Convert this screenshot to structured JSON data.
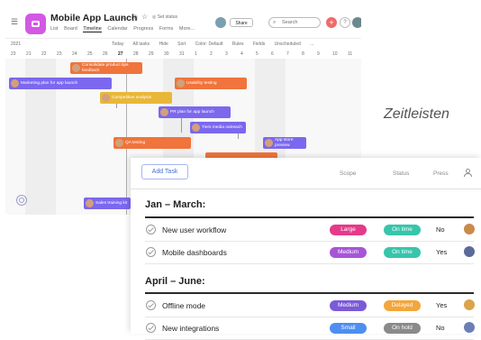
{
  "timeline": {
    "app_title": "Mobile App Launch",
    "set_status": "Set status",
    "tabs": [
      "List",
      "Board",
      "Timeline",
      "Calendar",
      "Progress",
      "Forms",
      "More..."
    ],
    "active_tab": "Timeline",
    "share": "Share",
    "search_placeholder": "Search",
    "month": "2021",
    "toolbar": [
      "Today",
      "All tasks",
      "Hide",
      "Sort",
      "Color: Default",
      "Rules",
      "Fields",
      "Unscheduled",
      "..."
    ],
    "dates": [
      "23",
      "21",
      "22",
      "23",
      "24",
      "25",
      "26",
      "27",
      "28",
      "29",
      "30",
      "31",
      "1",
      "2",
      "3",
      "4",
      "5",
      "6",
      "7",
      "8",
      "9",
      "10",
      "11"
    ],
    "today_index": 7,
    "tasks": [
      {
        "label": "Consolidate product tips feedback",
        "color": "orange"
      },
      {
        "label": "Marketing plan for app launch",
        "color": "blue"
      },
      {
        "label": "Usability testing",
        "color": "orange"
      },
      {
        "label": "Competitive analysis",
        "color": "yellow"
      },
      {
        "label": "PR plan for app launch",
        "color": "blue"
      },
      {
        "label": "Tiers media outreach",
        "color": "blue"
      },
      {
        "label": "QA testing",
        "color": "orange"
      },
      {
        "label": "App store preview",
        "color": "blue"
      },
      {
        "label": "Sales training kit",
        "color": "blue"
      }
    ],
    "colors": {
      "orange": "#f0743c",
      "blue": "#7b68ee",
      "yellow": "#e8b73a",
      "accent": "#d358e4"
    }
  },
  "caption": "Zeitleisten",
  "list": {
    "add_task": "Add Task",
    "columns": {
      "scope": "Scope",
      "status": "Status",
      "press": "Press"
    },
    "sections": [
      {
        "title": "Jan – March:",
        "rows": [
          {
            "name": "New user workflow",
            "scope": "Large",
            "scope_color": "#e53a8c",
            "status": "On time",
            "status_color": "#37c5ab",
            "press": "No",
            "avatar_color": "#c98a4a"
          },
          {
            "name": "Mobile dashboards",
            "scope": "Medium",
            "scope_color": "#a655d7",
            "status": "On time",
            "status_color": "#37c5ab",
            "press": "Yes",
            "avatar_color": "#5a6b9a"
          }
        ]
      },
      {
        "title": "April – June:",
        "rows": [
          {
            "name": "Offline mode",
            "scope": "Medium",
            "scope_color": "#7b5ad7",
            "status": "Delayed",
            "status_color": "#f3a63b",
            "press": "Yes",
            "avatar_color": "#d9a44a"
          },
          {
            "name": "New integrations",
            "scope": "Small",
            "scope_color": "#4e8ef0",
            "status": "On hold",
            "status_color": "#8a8a8a",
            "press": "No",
            "avatar_color": "#6b7fb5"
          }
        ]
      }
    ]
  }
}
